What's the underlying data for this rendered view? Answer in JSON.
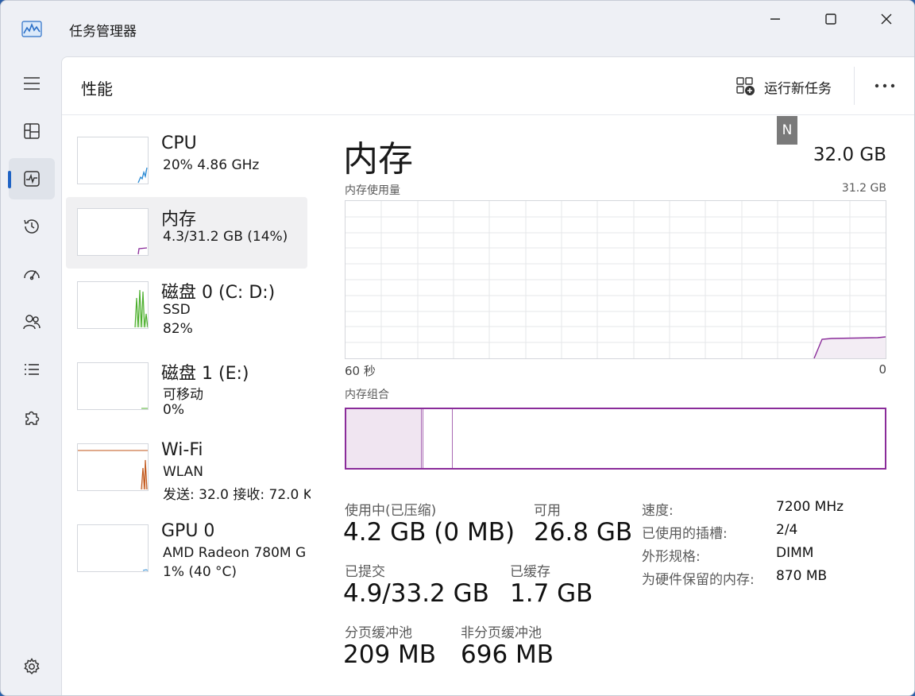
{
  "window": {
    "title": "任务管理器"
  },
  "header": {
    "page_title": "性能",
    "run_new_task": "运行新任务"
  },
  "devices": [
    {
      "name": "CPU",
      "sub1": "20%  4.86 GHz",
      "sub2": ""
    },
    {
      "name": "内存",
      "sub1": "4.3/31.2 GB (14%)",
      "sub2": ""
    },
    {
      "name": "磁盘 0 (C: D:)",
      "sub1": "SSD",
      "sub2": "82%"
    },
    {
      "name": "磁盘 1 (E:)",
      "sub1": "可移动",
      "sub2": "0%"
    },
    {
      "name": "Wi-Fi",
      "sub1": "WLAN",
      "sub2": "发送: 32.0  接收: 72.0 K"
    },
    {
      "name": "GPU 0",
      "sub1": "AMD Radeon 780M G",
      "sub2": "1%  (40 °C)"
    }
  ],
  "overlay_tag": "N",
  "memory": {
    "title": "内存",
    "capacity": "32.0 GB",
    "usage_label": "内存使用量",
    "usage_max": "31.2 GB",
    "time_left": "60 秒",
    "time_right": "0",
    "composition_label": "内存组合",
    "stats": {
      "in_use_label": "使用中(已压缩)",
      "in_use_value": "4.2 GB (0 MB)",
      "available_label": "可用",
      "available_value": "26.8 GB",
      "committed_label": "已提交",
      "committed_value": "4.9/33.2 GB",
      "cached_label": "已缓存",
      "cached_value": "1.7 GB",
      "paged_label": "分页缓冲池",
      "paged_value": "209 MB",
      "nonpaged_label": "非分页缓冲池",
      "nonpaged_value": "696 MB"
    },
    "specs": {
      "speed_label": "速度:",
      "speed_value": "7200 MHz",
      "slots_label": "已使用的插槽:",
      "slots_value": "2/4",
      "form_label": "外形规格:",
      "form_value": "DIMM",
      "reserved_label": "为硬件保留的内存:",
      "reserved_value": "870 MB"
    }
  },
  "colors": {
    "accent": "#1f63c4",
    "memory": "#8a2c9a",
    "cpu": "#2a8ad4",
    "disk": "#4caf2e",
    "wifi": "#c0561a"
  }
}
